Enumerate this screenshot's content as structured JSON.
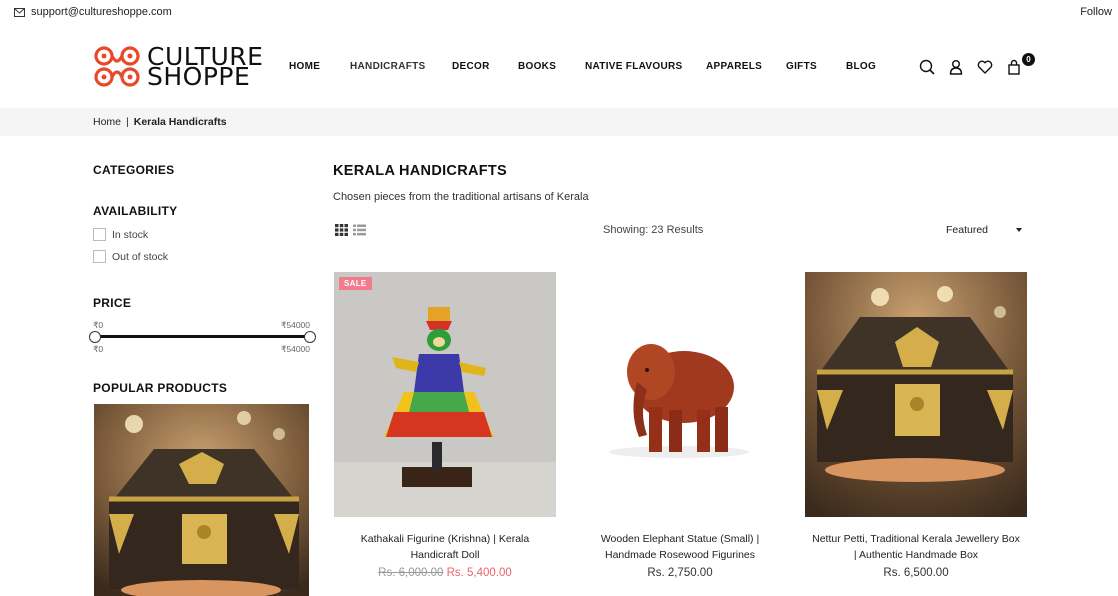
{
  "topbar": {
    "email": "support@cultureshoppe.com",
    "follow": "Follow"
  },
  "brand": {
    "line1": "CULTURE",
    "line2": "SHOPPE",
    "accent_color": "#e8492a"
  },
  "nav": [
    {
      "label": "HOME",
      "active": false
    },
    {
      "label": "HANDICRAFTS",
      "active": true
    },
    {
      "label": "DECOR",
      "active": false
    },
    {
      "label": "BOOKS",
      "active": false
    },
    {
      "label": "NATIVE FLAVOURS",
      "active": false
    },
    {
      "label": "APPARELS",
      "active": false
    },
    {
      "label": "GIFTS",
      "active": false
    },
    {
      "label": "BLOG",
      "active": false
    }
  ],
  "header_icons": [
    "search-icon",
    "user-icon",
    "heart-icon",
    "cart-icon"
  ],
  "cart": {
    "count": "0"
  },
  "breadcrumb": {
    "home": "Home",
    "separator": "|",
    "current": "Kerala Handicrafts"
  },
  "sidebar": {
    "categories_heading": "CATEGORIES",
    "availability_heading": "AVAILABILITY",
    "availability_options": [
      "In stock",
      "Out of stock"
    ],
    "price_heading": "PRICE",
    "price_min": "₹0",
    "price_max": "₹54000",
    "price_range_fraction": [
      0,
      1
    ],
    "popular_heading": "POPULAR PRODUCTS"
  },
  "main": {
    "title": "KERALA HANDICRAFTS",
    "subtitle": "Chosen pieces from the traditional artisans of Kerala",
    "showing": "Showing: 23 Results",
    "sort_selected": "Featured"
  },
  "products": [
    {
      "title": "Kathakali Figurine (Krishna) | Kerala Handicraft Doll",
      "old_price": "Rs. 6,000.00",
      "price": "Rs. 5,400.00",
      "badge": "SALE"
    },
    {
      "title": "Wooden Elephant Statue (Small) | Handmade Rosewood Figurines",
      "price": "Rs. 2,750.00"
    },
    {
      "title": "Nettur Petti, Traditional Kerala Jewellery Box | Authentic Handmade Box",
      "price": "Rs. 6,500.00"
    }
  ]
}
